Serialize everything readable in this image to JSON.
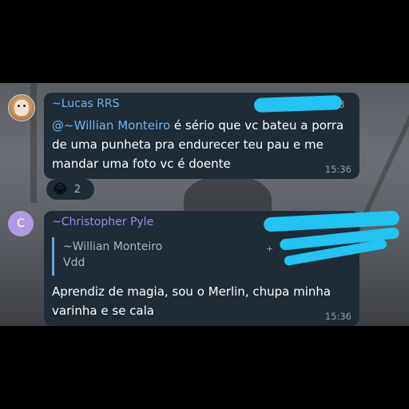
{
  "messages": [
    {
      "sender": "~Lucas RRS",
      "mention": "@~Willian Monteiro",
      "text": " é sério que vc bateu a porra de uma punheta pra endurecer teu pau e me mandar uma foto vc é doente",
      "time": "15:36",
      "corner_partial": "3",
      "reaction": {
        "emoji": "😂",
        "count": "2"
      }
    },
    {
      "avatar_letter": "C",
      "sender": "~Christopher Pyle",
      "reply": {
        "name": "~Willian Monteiro",
        "text": "Vdd",
        "partial": "+"
      },
      "text": "Aprendiz de magia, sou o Merlin, chupa minha varinha e se cala",
      "time": "15:36"
    }
  ],
  "colors": {
    "bubble": "#1f2b35",
    "sender1": "#73b5ea",
    "sender2": "#9b8ee8",
    "avatarC": "#b09ae0",
    "redaction": "#21c4f2"
  }
}
